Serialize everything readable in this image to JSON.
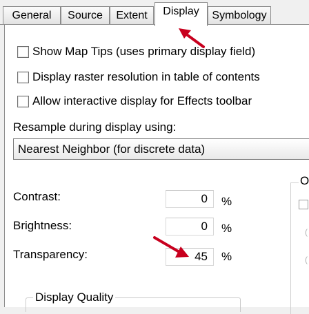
{
  "tabs": [
    {
      "label": "General"
    },
    {
      "label": "Source"
    },
    {
      "label": "Extent"
    },
    {
      "label": "Display"
    },
    {
      "label": "Symbology"
    }
  ],
  "checkboxes": [
    {
      "label": "Show Map Tips (uses primary display field)",
      "checked": false
    },
    {
      "label": "Display raster resolution in table of contents",
      "checked": false
    },
    {
      "label": "Allow interactive display for Effects toolbar",
      "checked": false
    }
  ],
  "resample": {
    "label": "Resample during display using:",
    "value": "Nearest Neighbor (for discrete data)"
  },
  "contrast": {
    "label": "Contrast:",
    "value": "0",
    "unit": "%"
  },
  "brightness": {
    "label": "Brightness:",
    "value": "0",
    "unit": "%"
  },
  "transparency": {
    "label": "Transparency:",
    "value": "45",
    "unit": "%"
  },
  "display_quality": {
    "title": "Display Quality"
  },
  "right_group": {
    "title_letter": "O"
  },
  "colors": {
    "annotation_arrow": "#c8001e",
    "tab_border": "#8c8c8c"
  },
  "icons": [
    "annotation-arrow-icon"
  ]
}
